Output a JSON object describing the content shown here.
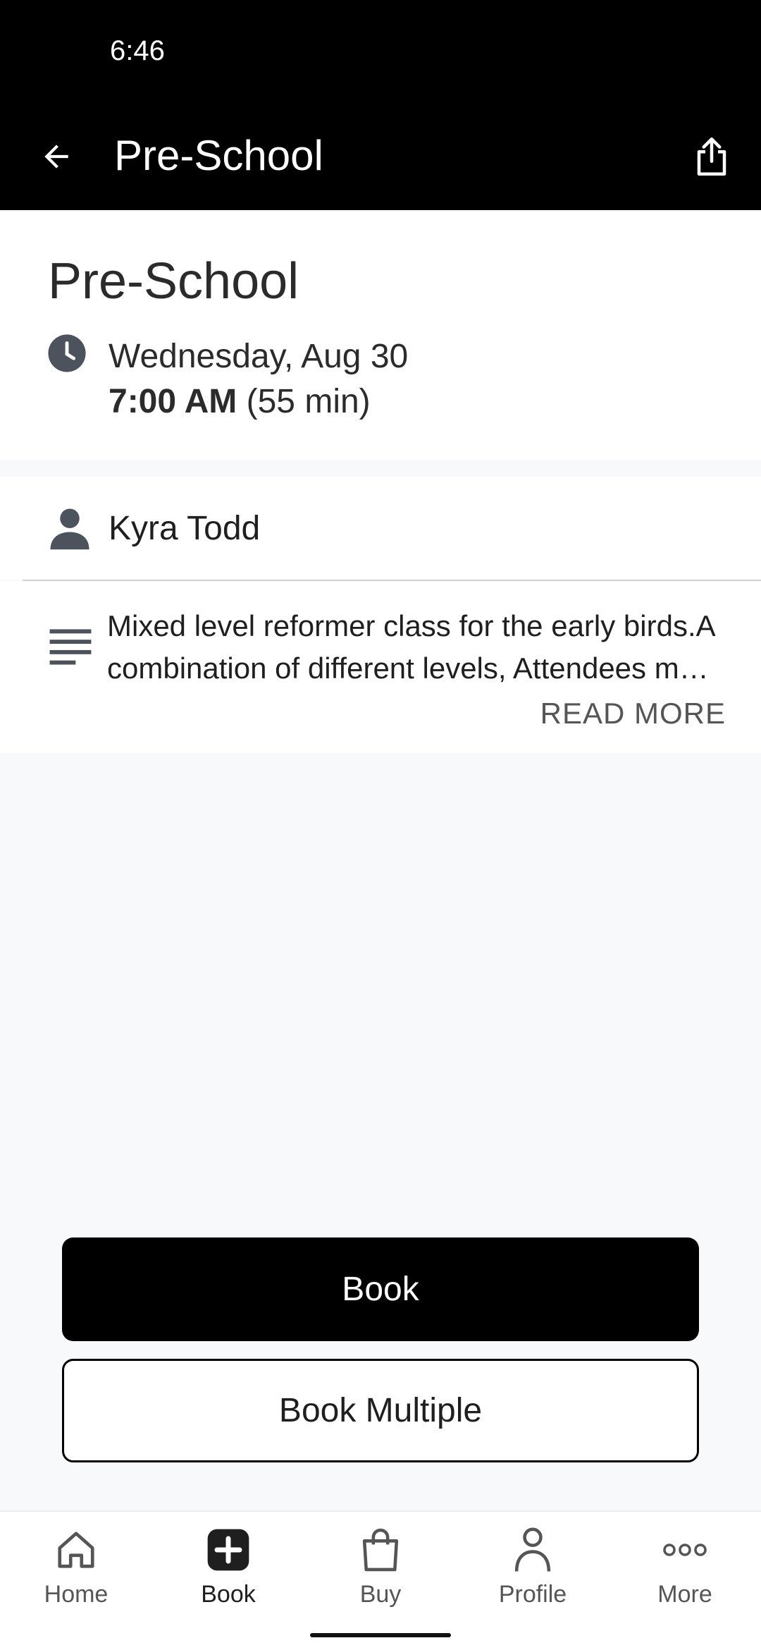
{
  "status_bar": {
    "time": "6:46"
  },
  "app_bar": {
    "title": "Pre-School",
    "back_icon": "arrow-left-icon",
    "share_icon": "share-icon"
  },
  "class": {
    "title": "Pre-School",
    "date": "Wednesday, Aug 30",
    "time": "7:00 AM",
    "duration": "(55 min)"
  },
  "instructor": {
    "name": "Kyra Todd"
  },
  "description": {
    "line1": "Mixed level reformer class for the early birds.A",
    "line2": "combination of different levels,  Attendees m…",
    "read_more": "READ MORE"
  },
  "actions": {
    "book": "Book",
    "book_multiple": "Book Multiple"
  },
  "bottom_nav": {
    "items": [
      {
        "label": "Home",
        "icon": "home-icon"
      },
      {
        "label": "Book",
        "icon": "plus-square-icon",
        "active": true
      },
      {
        "label": "Buy",
        "icon": "shopping-bag-icon"
      },
      {
        "label": "Profile",
        "icon": "person-icon"
      },
      {
        "label": "More",
        "icon": "more-dots-icon"
      }
    ]
  },
  "colors": {
    "app_bar": "#000000",
    "primary_button": "#000000",
    "background": "#f8f9fb",
    "icon_gray": "#4d535c"
  }
}
